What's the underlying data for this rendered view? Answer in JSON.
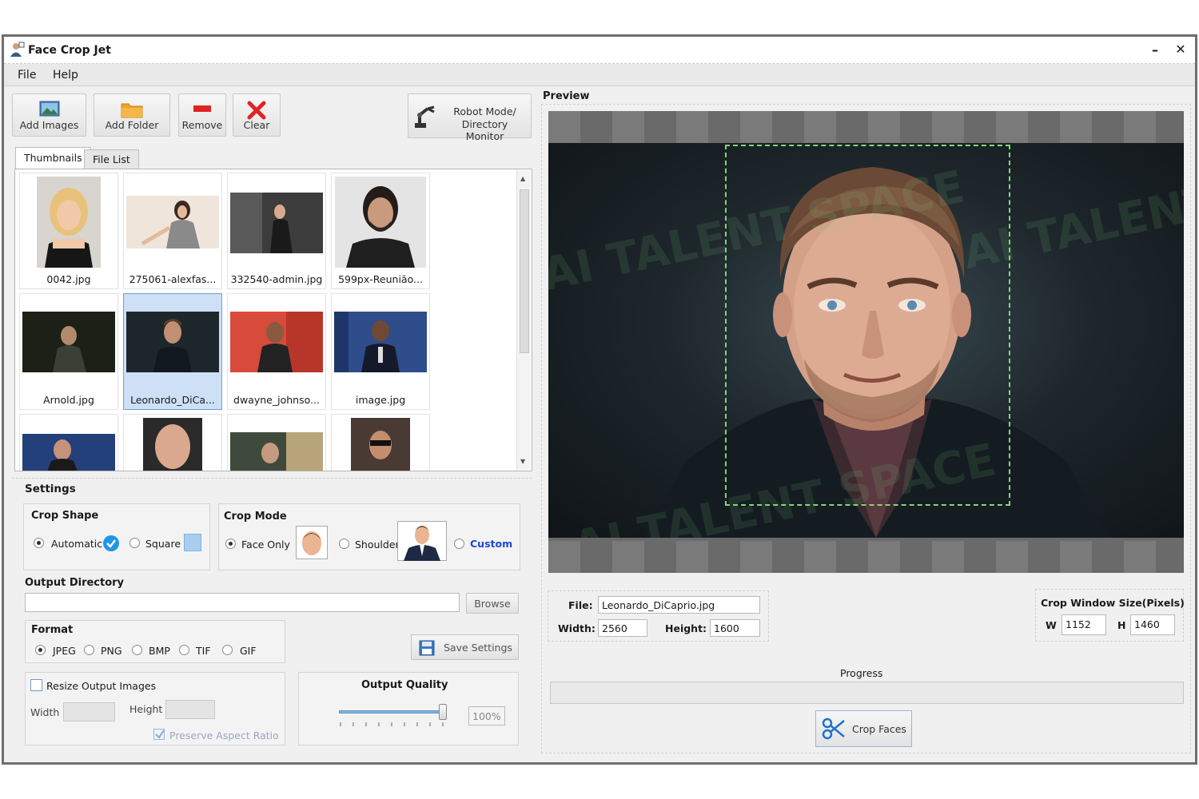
{
  "window": {
    "title": "Face Crop Jet",
    "minimize_glyph": "–",
    "close_glyph": "✕"
  },
  "menu": {
    "file": "File",
    "help": "Help"
  },
  "toolbar": {
    "add_images": "Add Images",
    "add_folder": "Add Folder",
    "remove": "Remove",
    "clear": "Clear",
    "robot_mode_line1": "Robot Mode/",
    "robot_mode_line2": "Directory Monitor"
  },
  "tabs": {
    "thumbnails": "Thumbnails",
    "file_list": "File List"
  },
  "thumbnails": [
    {
      "name": "0042.jpg",
      "selected": false
    },
    {
      "name": "275061-alexfas...",
      "selected": false
    },
    {
      "name": "332540-admin.jpg",
      "selected": false
    },
    {
      "name": "599px-Reunião...",
      "selected": false
    },
    {
      "name": "Arnold.jpg",
      "selected": false
    },
    {
      "name": "Leonardo_DiCa...",
      "selected": true
    },
    {
      "name": "dwayne_johnso...",
      "selected": false
    },
    {
      "name": "image.jpg",
      "selected": false
    }
  ],
  "settings": {
    "title": "Settings",
    "crop_shape": {
      "title": "Crop Shape",
      "automatic": "Automatic",
      "square": "Square",
      "selected": "automatic"
    },
    "crop_mode": {
      "title": "Crop Mode",
      "face_only": "Face Only",
      "shoulder": "Shoulder",
      "custom": "Custom",
      "selected": "face_only"
    },
    "output_directory": {
      "title": "Output Directory",
      "value": "",
      "browse": "Browse"
    },
    "format": {
      "title": "Format",
      "options": [
        "JPEG",
        "PNG",
        "BMP",
        "TIF",
        "GIF"
      ],
      "selected": "JPEG"
    },
    "save_settings": "Save Settings",
    "resize": {
      "label": "Resize Output Images",
      "checked": false,
      "width_label": "Width",
      "height_label": "Height",
      "width_value": "",
      "height_value": "",
      "preserve_aspect": "Preserve Aspect Ratio",
      "preserve_checked": true
    },
    "output_quality": {
      "title": "Output Quality",
      "value_text": "100%",
      "value": 1.0
    }
  },
  "preview": {
    "title": "Preview",
    "watermark": "AI TALENT SPACE"
  },
  "file_info": {
    "file_label": "File:",
    "file_value": "Leonardo_DiCaprio.jpg",
    "width_label": "Width:",
    "width_value": "2560",
    "height_label": "Height:",
    "height_value": "1600"
  },
  "crop_window": {
    "title": "Crop Window Size(Pixels)",
    "w_label": "W",
    "w_value": "1152",
    "h_label": "H",
    "h_value": "1460"
  },
  "progress": {
    "label": "Progress",
    "value": 0
  },
  "crop_faces": "Crop Faces",
  "colors": {
    "accent_blue": "#1d6fd6",
    "crop_rect": "#7fd96f",
    "selection": "#cde0f5",
    "remove_red": "#e02424"
  }
}
